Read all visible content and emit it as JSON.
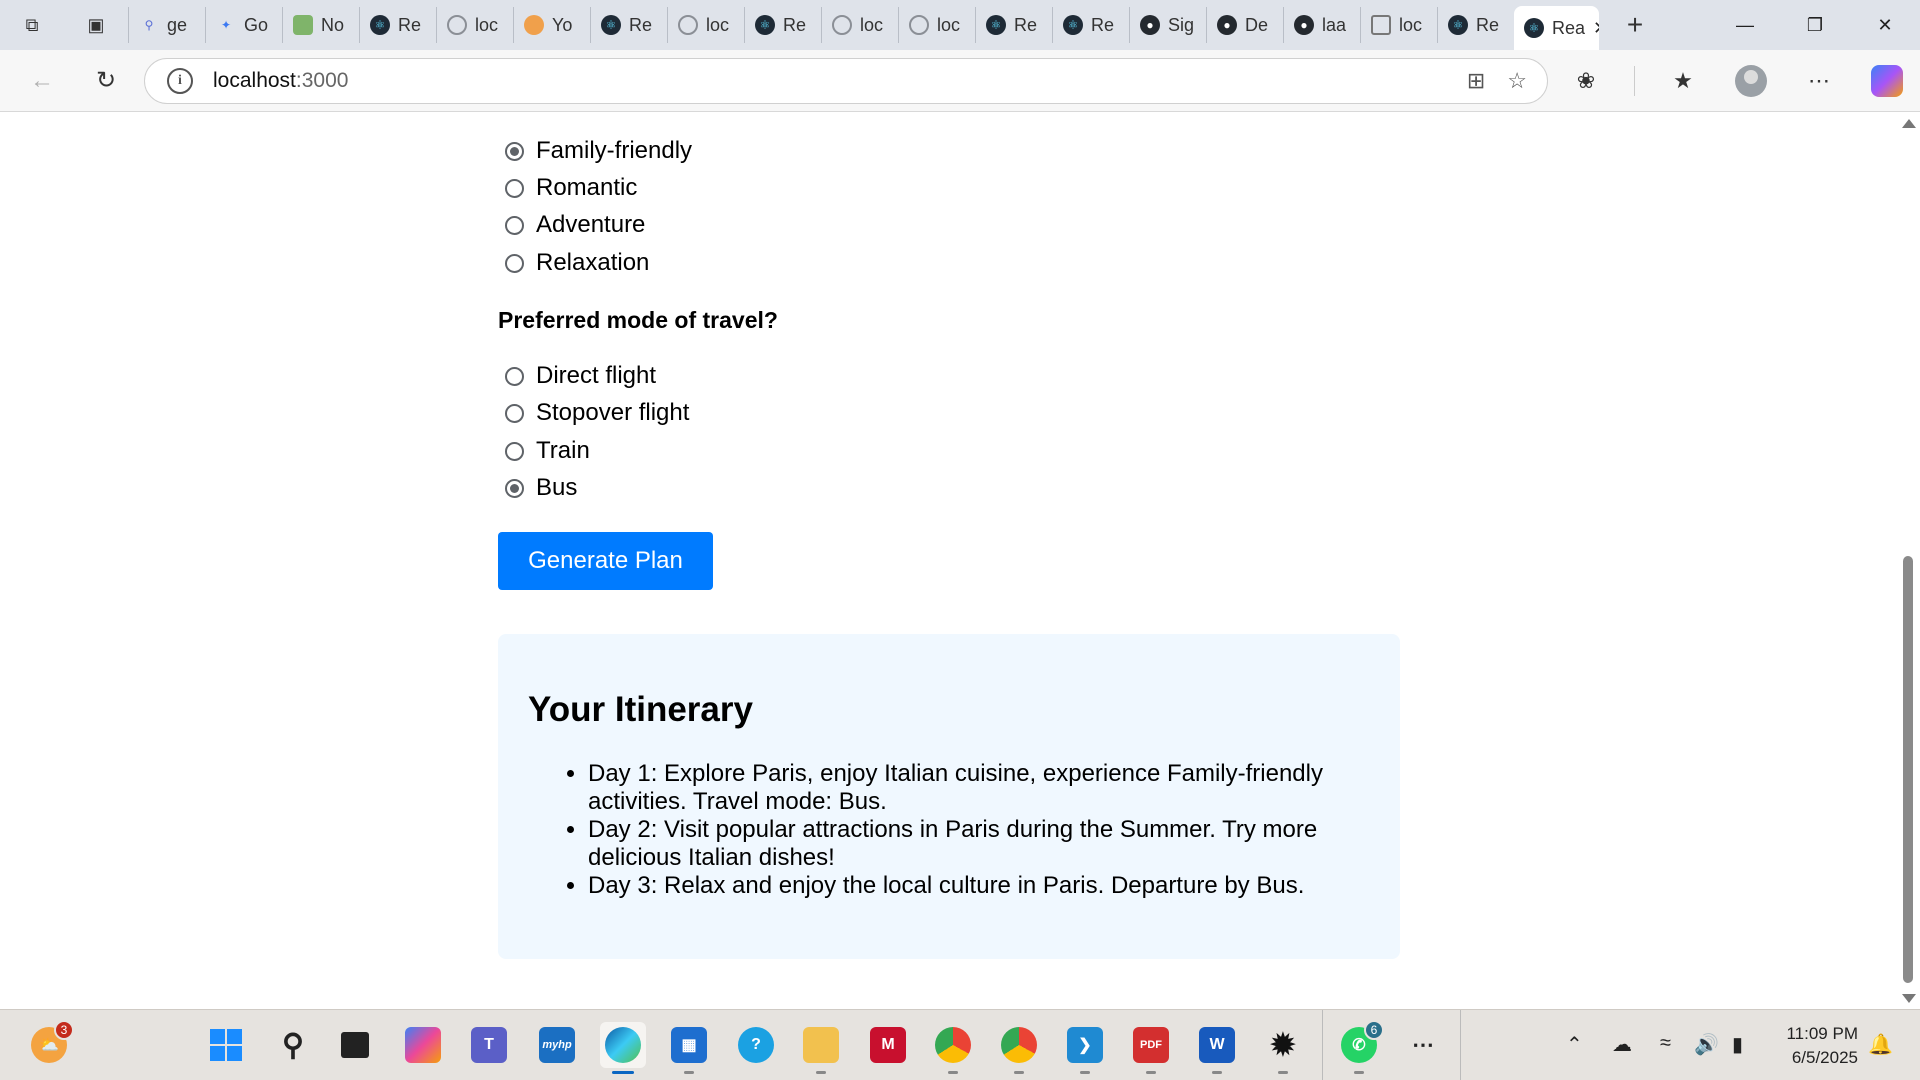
{
  "browser": {
    "tabs": [
      {
        "label": "ge",
        "favicon": "search-icon"
      },
      {
        "label": "Go",
        "favicon": "gemini-icon"
      },
      {
        "label": "No",
        "favicon": "node-icon"
      },
      {
        "label": "Re",
        "favicon": "react-icon"
      },
      {
        "label": "loc",
        "favicon": "globe-icon"
      },
      {
        "label": "Yo",
        "favicon": "cloud-icon"
      },
      {
        "label": "Re",
        "favicon": "react-icon"
      },
      {
        "label": "loc",
        "favicon": "globe-icon"
      },
      {
        "label": "Re",
        "favicon": "react-icon"
      },
      {
        "label": "loc",
        "favicon": "globe-icon"
      },
      {
        "label": "loc",
        "favicon": "globe-icon"
      },
      {
        "label": "Re",
        "favicon": "react-icon"
      },
      {
        "label": "Re",
        "favicon": "react-icon"
      },
      {
        "label": "Sig",
        "favicon": "github-icon"
      },
      {
        "label": "De",
        "favicon": "github-icon"
      },
      {
        "label": "laa",
        "favicon": "github-icon"
      },
      {
        "label": "loc",
        "favicon": "document-icon"
      },
      {
        "label": "Re",
        "favicon": "react-icon"
      }
    ],
    "active_tab": {
      "label": "Rea",
      "favicon": "react-icon"
    },
    "new_tab_symbol": "+",
    "url_host": "localhost",
    "url_port": ":3000"
  },
  "form": {
    "vibe_options": [
      {
        "label": "Family-friendly",
        "checked": true
      },
      {
        "label": "Romantic",
        "checked": false
      },
      {
        "label": "Adventure",
        "checked": false
      },
      {
        "label": "Relaxation",
        "checked": false
      }
    ],
    "travel_question": "Preferred mode of travel?",
    "travel_options": [
      {
        "label": "Direct flight",
        "checked": false
      },
      {
        "label": "Stopover flight",
        "checked": false
      },
      {
        "label": "Train",
        "checked": false
      },
      {
        "label": "Bus",
        "checked": true
      }
    ],
    "generate_button": "Generate Plan"
  },
  "itinerary": {
    "title": "Your Itinerary",
    "items": [
      "Day 1: Explore Paris, enjoy Italian cuisine, experience Family-friendly activities. Travel mode: Bus.",
      "Day 2: Visit popular attractions in Paris during the Summer. Try more delicious Italian dishes!",
      "Day 3: Relax and enjoy the local culture in Paris. Departure by Bus."
    ]
  },
  "taskbar": {
    "weather_badge": "3",
    "whatsapp_badge": "6",
    "time": "11:09 PM",
    "date": "6/5/2025"
  },
  "colors": {
    "primary_button": "#007bff",
    "itinerary_bg": "#f0f8ff",
    "edge_accent": "#0a66c2"
  }
}
